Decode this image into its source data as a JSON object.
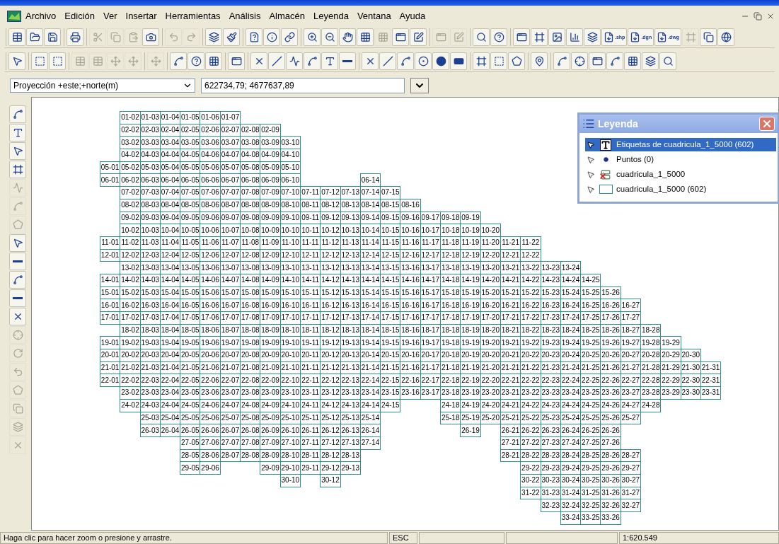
{
  "menu": [
    "Archivo",
    "Edición",
    "Ver",
    "Insertar",
    "Herramientas",
    "Análisis",
    "Almacén",
    "Leyenda",
    "Ventana",
    "Ayuda"
  ],
  "toolbars": [
    {
      "groups": [
        [
          {
            "kind": "table",
            "disabled": false
          },
          {
            "kind": "folder",
            "disabled": false
          },
          {
            "kind": "save",
            "disabled": false
          }
        ],
        [
          {
            "kind": "print",
            "disabled": false
          }
        ],
        [
          {
            "kind": "cut",
            "disabled": true
          },
          {
            "kind": "copy",
            "disabled": true
          },
          {
            "kind": "paste",
            "disabled": true
          },
          {
            "kind": "camera",
            "disabled": false
          }
        ],
        [
          {
            "kind": "undo",
            "disabled": true
          },
          {
            "kind": "redo",
            "disabled": true
          }
        ],
        [
          {
            "kind": "layers",
            "disabled": false
          },
          {
            "kind": "brush",
            "disabled": false
          }
        ],
        [
          {
            "kind": "query",
            "disabled": false
          },
          {
            "kind": "info",
            "disabled": false
          },
          {
            "kind": "link",
            "disabled": false
          }
        ],
        [
          {
            "kind": "zoom-in",
            "disabled": false
          },
          {
            "kind": "zoom-out",
            "disabled": false
          },
          {
            "kind": "pan",
            "disabled": false
          },
          {
            "kind": "grid",
            "disabled": false
          },
          {
            "kind": "grid",
            "disabled": true
          },
          {
            "kind": "window",
            "disabled": false
          },
          {
            "kind": "edit",
            "disabled": false
          }
        ],
        [
          {
            "kind": "window",
            "disabled": true
          },
          {
            "kind": "edit",
            "disabled": true
          }
        ],
        [
          {
            "kind": "search",
            "disabled": false
          },
          {
            "kind": "help",
            "disabled": false
          }
        ],
        [
          {
            "kind": "window",
            "disabled": false
          },
          {
            "kind": "frame",
            "disabled": false
          },
          {
            "kind": "image",
            "disabled": false
          },
          {
            "kind": "chart",
            "disabled": false
          },
          {
            "kind": "layers",
            "disabled": false
          },
          {
            "kind": "export",
            "disabled": false,
            "label": ".shp"
          },
          {
            "kind": "export",
            "disabled": false,
            "label": ".dgn"
          },
          {
            "kind": "export",
            "disabled": false,
            "label": ".dwg"
          },
          {
            "kind": "frame",
            "disabled": true
          },
          {
            "kind": "copy",
            "disabled": false
          },
          {
            "kind": "globe",
            "disabled": false
          }
        ]
      ]
    },
    {
      "groups": [
        [
          {
            "kind": "pointer",
            "disabled": false
          }
        ],
        [
          {
            "kind": "select",
            "disabled": false
          },
          {
            "kind": "select",
            "disabled": false
          }
        ],
        [
          {
            "kind": "table",
            "disabled": true
          },
          {
            "kind": "table",
            "disabled": true
          },
          {
            "kind": "move",
            "disabled": true
          },
          {
            "kind": "move",
            "disabled": true
          }
        ],
        [
          {
            "kind": "move",
            "disabled": true
          }
        ],
        [
          {
            "kind": "node",
            "disabled": false
          },
          {
            "kind": "help",
            "disabled": false
          },
          {
            "kind": "grid",
            "disabled": false
          }
        ],
        [
          {
            "kind": "window",
            "disabled": false
          }
        ],
        [
          {
            "kind": "cross",
            "disabled": false
          },
          {
            "kind": "line",
            "disabled": false
          },
          {
            "kind": "polyline",
            "disabled": false
          },
          {
            "kind": "node",
            "disabled": false
          },
          {
            "kind": "text",
            "disabled": false
          },
          {
            "kind": "minus",
            "disabled": false
          }
        ],
        [
          {
            "kind": "cross",
            "disabled": false
          },
          {
            "kind": "line",
            "disabled": false
          },
          {
            "kind": "curve",
            "disabled": false
          },
          {
            "kind": "ring",
            "disabled": false
          },
          {
            "kind": "dot",
            "disabled": false
          },
          {
            "kind": "bar",
            "disabled": false
          }
        ],
        [
          {
            "kind": "frame",
            "disabled": false
          },
          {
            "kind": "select",
            "disabled": false
          },
          {
            "kind": "shape",
            "disabled": false
          }
        ],
        [
          {
            "kind": "pin",
            "disabled": false
          }
        ],
        [
          {
            "kind": "node",
            "disabled": false
          },
          {
            "kind": "crosshair",
            "disabled": false
          },
          {
            "kind": "window",
            "disabled": false
          },
          {
            "kind": "curve",
            "disabled": false
          },
          {
            "kind": "grid",
            "disabled": false
          },
          {
            "kind": "layers",
            "disabled": false
          },
          {
            "kind": "search",
            "disabled": false
          }
        ]
      ]
    }
  ],
  "projection": {
    "value": "Proyección +este;+norte(m)"
  },
  "coordinates": {
    "value": "622734,79; 4677637,89"
  },
  "side_tools": [
    {
      "kind": "node",
      "disabled": false
    },
    {
      "kind": "text",
      "disabled": false
    },
    {
      "kind": "pointer",
      "disabled": false
    },
    {
      "kind": "frame",
      "disabled": false
    },
    {
      "kind": "polyline",
      "disabled": true
    },
    {
      "kind": "curve",
      "disabled": true
    },
    {
      "kind": "shape",
      "disabled": true
    },
    {
      "kind": "pointer",
      "disabled": false
    },
    {
      "kind": "minus",
      "disabled": false
    },
    {
      "kind": "node",
      "disabled": false
    },
    {
      "kind": "minus",
      "disabled": false
    },
    {
      "kind": "cross",
      "disabled": false
    },
    {
      "kind": "crosshair",
      "disabled": true
    },
    {
      "kind": "rotate",
      "disabled": true
    },
    {
      "kind": "undo",
      "disabled": true
    },
    {
      "kind": "shape",
      "disabled": true
    },
    {
      "kind": "copy",
      "disabled": true
    },
    {
      "kind": "layers",
      "disabled": true
    },
    {
      "kind": "cross",
      "disabled": true
    }
  ],
  "map": {
    "rows": [
      {
        "cells": [
          null,
          "01-02",
          "01-03",
          "01-04",
          "01-05",
          "01-06",
          "01-07"
        ]
      },
      {
        "cells": [
          null,
          "02-02",
          "02-03",
          "02-04",
          "02-05",
          "02-06",
          "02-07",
          "02-08",
          "02-09"
        ]
      },
      {
        "cells": [
          null,
          "03-02",
          "03-03",
          "03-04",
          "03-05",
          "03-06",
          "03-07",
          "03-08",
          "03-09",
          "03-10"
        ]
      },
      {
        "cells": [
          null,
          "04-02",
          "04-03",
          "04-04",
          "04-05",
          "04-06",
          "04-07",
          "04-08",
          "04-09",
          "04-10"
        ]
      },
      {
        "cells": [
          "05-01",
          "05-02",
          "05-03",
          "05-04",
          "05-05",
          "05-06",
          "05-07",
          "05-08",
          "05-09",
          "05-10"
        ]
      },
      {
        "cells": [
          "06-01",
          "06-02",
          "06-03",
          "06-04",
          "06-05",
          "06-06",
          "06-07",
          "06-08",
          "06-09",
          "06-10",
          null,
          null,
          null,
          "06-14"
        ]
      },
      {
        "cells": [
          null,
          "07-02",
          "07-03",
          "07-04",
          "07-05",
          "07-06",
          "07-07",
          "07-08",
          "07-09",
          "07-10",
          "07-11",
          "07-12",
          "07-13",
          "07-14",
          "07-15"
        ]
      },
      {
        "cells": [
          null,
          "08-02",
          "08-03",
          "08-04",
          "08-05",
          "08-06",
          "08-07",
          "08-08",
          "08-09",
          "08-10",
          "08-11",
          "08-12",
          "08-13",
          "08-14",
          "08-15",
          "08-16"
        ]
      },
      {
        "cells": [
          null,
          "09-02",
          "09-03",
          "09-04",
          "09-05",
          "09-06",
          "09-07",
          "09-08",
          "09-09",
          "09-10",
          "09-11",
          "09-12",
          "09-13",
          "09-14",
          "09-15",
          "09-16",
          "09-17",
          "09-18",
          "09-19"
        ]
      },
      {
        "cells": [
          null,
          "10-02",
          "10-03",
          "10-04",
          "10-05",
          "10-06",
          "10-07",
          "10-08",
          "10-09",
          "10-10",
          "10-11",
          "10-12",
          "10-13",
          "10-14",
          "10-15",
          "10-16",
          "10-17",
          "10-18",
          "10-19",
          "10-20"
        ]
      },
      {
        "cells": [
          "11-01",
          "11-02",
          "11-03",
          "11-04",
          "11-05",
          "11-06",
          "11-07",
          "11-08",
          "11-09",
          "11-10",
          "11-11",
          "11-12",
          "11-13",
          "11-14",
          "11-15",
          "11-16",
          "11-17",
          "11-18",
          "11-19",
          "11-20",
          "11-21",
          "11-22"
        ]
      },
      {
        "cells": [
          "12-01",
          "12-02",
          "12-03",
          "12-04",
          "12-05",
          "12-06",
          "12-07",
          "12-08",
          "12-09",
          "12-10",
          "12-11",
          "12-12",
          "12-13",
          "12-14",
          "12-15",
          "12-16",
          "12-17",
          "12-18",
          "12-19",
          "12-20",
          "12-21",
          "12-22"
        ]
      },
      {
        "cells": [
          null,
          "13-02",
          "13-03",
          "13-04",
          "13-05",
          "13-06",
          "13-07",
          "13-08",
          "13-09",
          "13-10",
          "13-11",
          "13-12",
          "13-13",
          "13-14",
          "13-15",
          "13-16",
          "13-17",
          "13-18",
          "13-19",
          "13-20",
          "13-21",
          "13-22",
          "13-23",
          "13-24"
        ]
      },
      {
        "cells": [
          "14-01",
          "14-02",
          "14-03",
          "14-04",
          "14-05",
          "14-06",
          "14-07",
          "14-08",
          "14-09",
          "14-10",
          "14-11",
          "14-12",
          "14-13",
          "14-14",
          "14-15",
          "14-16",
          "14-17",
          "14-18",
          "14-19",
          "14-20",
          "14-21",
          "14-22",
          "14-23",
          "14-24",
          "14-25"
        ]
      },
      {
        "cells": [
          "15-01",
          "15-02",
          "15-03",
          "15-04",
          "15-05",
          "15-06",
          "15-07",
          "15-08",
          "15-09",
          "15-10",
          "15-11",
          "15-12",
          "15-13",
          "15-14",
          "15-15",
          "15-16",
          "15-17",
          "15-18",
          "15-19",
          "15-20",
          "15-21",
          "15-22",
          "15-23",
          "15-24",
          "15-25",
          "15-26"
        ]
      },
      {
        "cells": [
          "16-01",
          "16-02",
          "16-03",
          "16-04",
          "16-05",
          "16-06",
          "16-07",
          "16-08",
          "16-09",
          "16-10",
          "16-11",
          "16-12",
          "16-13",
          "16-14",
          "16-15",
          "16-16",
          "16-17",
          "16-18",
          "16-19",
          "16-20",
          "16-21",
          "16-22",
          "16-23",
          "16-24",
          "16-25",
          "16-26",
          "16-27"
        ]
      },
      {
        "cells": [
          "17-01",
          "17-02",
          "17-03",
          "17-04",
          "17-05",
          "17-06",
          "17-07",
          "17-08",
          "17-09",
          "17-10",
          "17-11",
          "17-12",
          "17-13",
          "17-14",
          "17-15",
          "17-16",
          "17-17",
          "17-18",
          "17-19",
          "17-20",
          "17-21",
          "17-22",
          "17-23",
          "17-24",
          "17-25",
          "17-26",
          "17-27"
        ]
      },
      {
        "cells": [
          null,
          "18-02",
          "18-03",
          "18-04",
          "18-05",
          "18-06",
          "18-07",
          "18-08",
          "18-09",
          "18-10",
          "18-11",
          "18-12",
          "18-13",
          "18-14",
          "18-15",
          "18-16",
          "18-17",
          "18-18",
          "18-19",
          "18-20",
          "18-21",
          "18-22",
          "18-23",
          "18-24",
          "18-25",
          "18-26",
          "18-27",
          "18-28"
        ]
      },
      {
        "cells": [
          "19-01",
          "19-02",
          "19-03",
          "19-04",
          "19-05",
          "19-06",
          "19-07",
          "19-08",
          "19-09",
          "19-10",
          "19-11",
          "19-12",
          "19-13",
          "19-14",
          "19-15",
          "19-16",
          "19-17",
          "19-18",
          "19-19",
          "19-20",
          "19-21",
          "19-22",
          "19-23",
          "19-24",
          "19-25",
          "19-26",
          "19-27",
          "19-28",
          "19-29"
        ]
      },
      {
        "cells": [
          "20-01",
          "20-02",
          "20-03",
          "20-04",
          "20-05",
          "20-06",
          "20-07",
          "20-08",
          "20-09",
          "20-10",
          "20-11",
          "20-12",
          "20-13",
          "20-14",
          "20-15",
          "20-16",
          "20-17",
          "20-18",
          "20-19",
          "20-20",
          "20-21",
          "20-22",
          "20-23",
          "20-24",
          "20-25",
          "20-26",
          "20-27",
          "20-28",
          "20-29",
          "20-30"
        ]
      },
      {
        "cells": [
          "21-01",
          "21-02",
          "21-03",
          "21-04",
          "21-05",
          "21-06",
          "21-07",
          "21-08",
          "21-09",
          "21-10",
          "21-11",
          "21-12",
          "21-13",
          "21-14",
          "21-15",
          "21-16",
          "21-17",
          "21-18",
          "21-19",
          "21-20",
          "21-21",
          "21-22",
          "21-23",
          "21-24",
          "21-25",
          "21-26",
          "21-27",
          "21-28",
          "21-29",
          "21-30",
          "21-31"
        ]
      },
      {
        "cells": [
          "22-01",
          "22-02",
          "22-03",
          "22-04",
          "22-05",
          "22-06",
          "22-07",
          "22-08",
          "22-09",
          "22-10",
          "22-11",
          "22-12",
          "22-13",
          "22-14",
          "22-15",
          "22-16",
          "22-17",
          "22-18",
          "22-19",
          "22-20",
          "22-21",
          "22-22",
          "22-23",
          "22-24",
          "22-25",
          "22-26",
          "22-27",
          "22-28",
          "22-29",
          "22-30",
          "22-31"
        ]
      },
      {
        "cells": [
          null,
          "23-02",
          "23-03",
          "23-04",
          "23-05",
          "23-06",
          "23-07",
          "23-08",
          "23-09",
          "23-10",
          "23-11",
          "23-12",
          "23-13",
          "23-14",
          "23-15",
          "23-16",
          "23-17",
          "23-18",
          "23-19",
          "23-20",
          "23-21",
          "23-22",
          "23-23",
          "23-24",
          "23-25",
          "23-26",
          "23-27",
          "23-28",
          "23-29",
          "23-30",
          "23-31"
        ]
      },
      {
        "cells": [
          null,
          "24-02",
          "24-03",
          "24-04",
          "24-05",
          "24-06",
          "24-07",
          "24-08",
          "24-09",
          "24-10",
          "24-11",
          "24-12",
          "24-13",
          "24-14",
          "24-15",
          null,
          null,
          "24-18",
          "24-19",
          "24-20",
          "24-21",
          "24-22",
          "24-23",
          "24-24",
          "24-25",
          "24-26",
          "24-27",
          "24-28"
        ]
      },
      {
        "cells": [
          null,
          null,
          "25-03",
          "25-04",
          "25-05",
          "25-06",
          "25-07",
          "25-08",
          "25-09",
          "25-10",
          "25-11",
          "25-12",
          "25-13",
          "25-14",
          null,
          null,
          null,
          "25-18",
          "25-19",
          "25-20",
          "25-21",
          "25-22",
          "25-23",
          "25-24",
          "25-25",
          "25-26",
          "25-27"
        ]
      },
      {
        "cells": [
          null,
          null,
          "26-03",
          "26-04",
          "26-05",
          "26-06",
          "26-07",
          "26-08",
          "26-09",
          "26-10",
          "26-11",
          "26-12",
          "26-13",
          "26-14",
          null,
          null,
          null,
          null,
          "26-19",
          null,
          "26-21",
          "26-22",
          "26-23",
          "26-24",
          "26-25",
          "26-26"
        ]
      },
      {
        "cells": [
          null,
          null,
          null,
          null,
          "27-05",
          "27-06",
          "27-07",
          "27-08",
          "27-09",
          "27-10",
          "27-11",
          "27-12",
          "27-13",
          "27-14",
          null,
          null,
          null,
          null,
          null,
          null,
          "27-21",
          "27-22",
          "27-23",
          "27-24",
          "27-25",
          "27-26"
        ]
      },
      {
        "cells": [
          null,
          null,
          null,
          null,
          "28-05",
          "28-06",
          "28-07",
          "28-08",
          "28-09",
          "28-10",
          "28-11",
          "28-12",
          "28-13",
          null,
          null,
          null,
          null,
          null,
          null,
          null,
          "28-21",
          "28-22",
          "28-23",
          "28-24",
          "28-25",
          "28-26",
          "28-27"
        ]
      },
      {
        "cells": [
          null,
          null,
          null,
          null,
          "29-05",
          "29-06",
          null,
          null,
          "29-09",
          "29-10",
          "29-11",
          "29-12",
          "29-13",
          null,
          null,
          null,
          null,
          null,
          null,
          null,
          null,
          "29-22",
          "29-23",
          "29-24",
          "29-25",
          "29-26",
          "29-27"
        ]
      },
      {
        "cells": [
          null,
          null,
          null,
          null,
          null,
          null,
          null,
          null,
          null,
          "30-10",
          null,
          "30-12",
          null,
          null,
          null,
          null,
          null,
          null,
          null,
          null,
          null,
          "30-22",
          "30-23",
          "30-24",
          "30-25",
          "30-26",
          "30-27"
        ]
      },
      {
        "cells": [
          null,
          null,
          null,
          null,
          null,
          null,
          null,
          null,
          null,
          null,
          null,
          null,
          null,
          null,
          null,
          null,
          null,
          null,
          null,
          null,
          null,
          "31-22",
          "31-23",
          "31-24",
          "31-25",
          "31-26",
          "31-27"
        ]
      },
      {
        "cells": [
          null,
          null,
          null,
          null,
          null,
          null,
          null,
          null,
          null,
          null,
          null,
          null,
          null,
          null,
          null,
          null,
          null,
          null,
          null,
          null,
          null,
          null,
          "32-23",
          "32-24",
          "32-25",
          "32-26",
          "32-27"
        ]
      },
      {
        "cells": [
          null,
          null,
          null,
          null,
          null,
          null,
          null,
          null,
          null,
          null,
          null,
          null,
          null,
          null,
          null,
          null,
          null,
          null,
          null,
          null,
          null,
          null,
          null,
          "33-24",
          "33-25",
          "33-26"
        ]
      }
    ]
  },
  "legend": {
    "title": "Leyenda",
    "items": [
      {
        "kind": "labels",
        "label": "Etiquetas de cuadricula_1_5000  (602)",
        "selected": true
      },
      {
        "kind": "points",
        "label": "Puntos  (0)",
        "selected": false
      },
      {
        "kind": "cosmetic",
        "label": "cuadricula_1_5000",
        "selected": false
      },
      {
        "kind": "regions",
        "label": "cuadricula_1_5000  (602)",
        "selected": false
      }
    ]
  },
  "status_bar": {
    "message": "Haga clic para hacer zoom o presione y arrastre.",
    "mode": "ESC",
    "scale": "1:620.549"
  }
}
